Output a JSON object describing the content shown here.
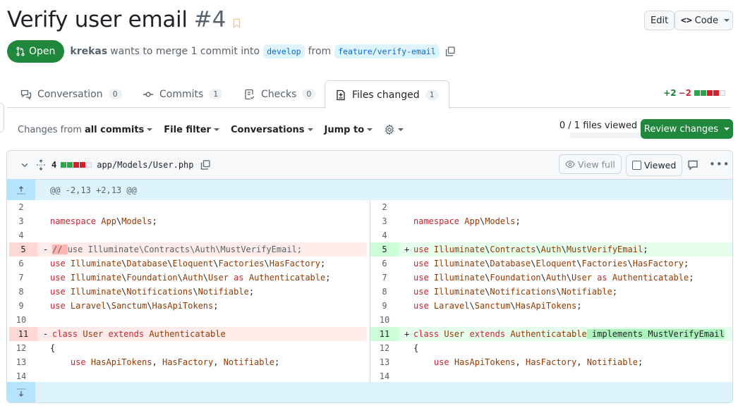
{
  "header": {
    "title": "Verify user email",
    "number": "#4",
    "edit_label": "Edit",
    "code_label": "Code",
    "code_icon": "<>"
  },
  "meta": {
    "state": "Open",
    "author": "krekas",
    "merge_text": "wants to merge 1 commit into",
    "base_branch": "develop",
    "from_text": "from",
    "head_branch": "feature/verify-email"
  },
  "tabs": [
    {
      "label": "Conversation",
      "count": "0",
      "icon": "comment-discussion-icon"
    },
    {
      "label": "Commits",
      "count": "1",
      "icon": "git-commit-icon"
    },
    {
      "label": "Checks",
      "count": "0",
      "icon": "checklist-icon"
    },
    {
      "label": "Files changed",
      "count": "1",
      "icon": "file-diff-icon",
      "active": true
    }
  ],
  "diffstat": {
    "additions": "+2",
    "deletions": "−2",
    "blocks": [
      "added",
      "added",
      "deleted",
      "deleted",
      "neutral"
    ]
  },
  "toolbar": {
    "changes_from_prefix": "Changes from",
    "changes_from_value": "all commits",
    "file_filter": "File filter",
    "conversations": "Conversations",
    "jump_to": "Jump to",
    "files_viewed": "0 / 1 files viewed",
    "files_viewed_fraction": 0,
    "review_changes": "Review changes"
  },
  "file": {
    "changed_count": "4",
    "path": "app/Models/User.php",
    "view_full": "View full",
    "viewed": "Viewed",
    "viewed_checked": false,
    "hunk_header": "@@ -2,13 +2,13 @@"
  },
  "colors": {
    "open_green": "#1f883d",
    "addition_bg": "#e6ffec",
    "deletion_bg": "#ffebe9",
    "hunk_bg": "#ddf4ff",
    "branch_blue": "#0969da"
  },
  "diff": {
    "left": [
      {
        "num": "2",
        "type": "ctx",
        "tokens": []
      },
      {
        "num": "3",
        "type": "ctx",
        "tokens": [
          [
            "kw",
            "namespace"
          ],
          [
            "",
            " "
          ],
          [
            "nm",
            "App"
          ],
          [
            "",
            "\\"
          ],
          [
            "nm",
            "Models"
          ],
          [
            "",
            ";"
          ]
        ]
      },
      {
        "num": "4",
        "type": "ctx",
        "tokens": []
      },
      {
        "num": "5",
        "type": "del",
        "tokens": [
          [
            "cm hl-del",
            "//"
          ],
          [
            "hl-del",
            " "
          ],
          [
            "cm",
            "use Illuminate\\Contracts\\Auth\\MustVerifyEmail;"
          ]
        ]
      },
      {
        "num": "6",
        "type": "ctx",
        "tokens": [
          [
            "kw",
            "use"
          ],
          [
            "",
            " "
          ],
          [
            "nm",
            "Illuminate"
          ],
          [
            "",
            "\\"
          ],
          [
            "nm",
            "Database"
          ],
          [
            "",
            "\\"
          ],
          [
            "nm",
            "Eloquent"
          ],
          [
            "",
            "\\"
          ],
          [
            "nm",
            "Factories"
          ],
          [
            "",
            "\\"
          ],
          [
            "nm",
            "HasFactory"
          ],
          [
            "",
            ";"
          ]
        ]
      },
      {
        "num": "7",
        "type": "ctx",
        "tokens": [
          [
            "kw",
            "use"
          ],
          [
            "",
            " "
          ],
          [
            "nm",
            "Illuminate"
          ],
          [
            "",
            "\\"
          ],
          [
            "nm",
            "Foundation"
          ],
          [
            "",
            "\\"
          ],
          [
            "nm",
            "Auth"
          ],
          [
            "",
            "\\"
          ],
          [
            "nm",
            "User"
          ],
          [
            "",
            " "
          ],
          [
            "kw",
            "as"
          ],
          [
            "",
            " "
          ],
          [
            "nm",
            "Authenticatable"
          ],
          [
            "",
            ";"
          ]
        ]
      },
      {
        "num": "8",
        "type": "ctx",
        "tokens": [
          [
            "kw",
            "use"
          ],
          [
            "",
            " "
          ],
          [
            "nm",
            "Illuminate"
          ],
          [
            "",
            "\\"
          ],
          [
            "nm",
            "Notifications"
          ],
          [
            "",
            "\\"
          ],
          [
            "nm",
            "Notifiable"
          ],
          [
            "",
            ";"
          ]
        ]
      },
      {
        "num": "9",
        "type": "ctx",
        "tokens": [
          [
            "kw",
            "use"
          ],
          [
            "",
            " "
          ],
          [
            "nm",
            "Laravel"
          ],
          [
            "",
            "\\"
          ],
          [
            "nm",
            "Sanctum"
          ],
          [
            "",
            "\\"
          ],
          [
            "nm",
            "HasApiTokens"
          ],
          [
            "",
            ";"
          ]
        ]
      },
      {
        "num": "10",
        "type": "ctx",
        "tokens": []
      },
      {
        "num": "11",
        "type": "del",
        "tokens": [
          [
            "kw",
            "class"
          ],
          [
            "",
            " "
          ],
          [
            "nm",
            "User"
          ],
          [
            "",
            " "
          ],
          [
            "kw",
            "extends"
          ],
          [
            "",
            " "
          ],
          [
            "nm",
            "Authenticatable"
          ]
        ]
      },
      {
        "num": "12",
        "type": "ctx",
        "tokens": [
          [
            "",
            "{"
          ]
        ]
      },
      {
        "num": "13",
        "type": "ctx",
        "tokens": [
          [
            "",
            "    "
          ],
          [
            "kw",
            "use"
          ],
          [
            "",
            " "
          ],
          [
            "nm",
            "HasApiTokens"
          ],
          [
            "",
            ", "
          ],
          [
            "nm",
            "HasFactory"
          ],
          [
            "",
            ", "
          ],
          [
            "nm",
            "Notifiable"
          ],
          [
            "",
            ";"
          ]
        ]
      },
      {
        "num": "14",
        "type": "ctx",
        "tokens": []
      }
    ],
    "right": [
      {
        "num": "2",
        "type": "ctx",
        "tokens": []
      },
      {
        "num": "3",
        "type": "ctx",
        "tokens": [
          [
            "kw",
            "namespace"
          ],
          [
            "",
            " "
          ],
          [
            "nm",
            "App"
          ],
          [
            "",
            "\\"
          ],
          [
            "nm",
            "Models"
          ],
          [
            "",
            ";"
          ]
        ]
      },
      {
        "num": "4",
        "type": "ctx",
        "tokens": []
      },
      {
        "num": "5",
        "type": "add",
        "tokens": [
          [
            "kw",
            "use"
          ],
          [
            "",
            " "
          ],
          [
            "nm",
            "Illuminate"
          ],
          [
            "",
            "\\"
          ],
          [
            "nm",
            "Contracts"
          ],
          [
            "",
            "\\"
          ],
          [
            "nm",
            "Auth"
          ],
          [
            "",
            "\\"
          ],
          [
            "nm",
            "MustVerifyEmail"
          ],
          [
            "",
            ";"
          ]
        ]
      },
      {
        "num": "6",
        "type": "ctx",
        "tokens": [
          [
            "kw",
            "use"
          ],
          [
            "",
            " "
          ],
          [
            "nm",
            "Illuminate"
          ],
          [
            "",
            "\\"
          ],
          [
            "nm",
            "Database"
          ],
          [
            "",
            "\\"
          ],
          [
            "nm",
            "Eloquent"
          ],
          [
            "",
            "\\"
          ],
          [
            "nm",
            "Factories"
          ],
          [
            "",
            "\\"
          ],
          [
            "nm",
            "HasFactory"
          ],
          [
            "",
            ";"
          ]
        ]
      },
      {
        "num": "7",
        "type": "ctx",
        "tokens": [
          [
            "kw",
            "use"
          ],
          [
            "",
            " "
          ],
          [
            "nm",
            "Illuminate"
          ],
          [
            "",
            "\\"
          ],
          [
            "nm",
            "Foundation"
          ],
          [
            "",
            "\\"
          ],
          [
            "nm",
            "Auth"
          ],
          [
            "",
            "\\"
          ],
          [
            "nm",
            "User"
          ],
          [
            "",
            " "
          ],
          [
            "kw",
            "as"
          ],
          [
            "",
            " "
          ],
          [
            "nm",
            "Authenticatable"
          ],
          [
            "",
            ";"
          ]
        ]
      },
      {
        "num": "8",
        "type": "ctx",
        "tokens": [
          [
            "kw",
            "use"
          ],
          [
            "",
            " "
          ],
          [
            "nm",
            "Illuminate"
          ],
          [
            "",
            "\\"
          ],
          [
            "nm",
            "Notifications"
          ],
          [
            "",
            "\\"
          ],
          [
            "nm",
            "Notifiable"
          ],
          [
            "",
            ";"
          ]
        ]
      },
      {
        "num": "9",
        "type": "ctx",
        "tokens": [
          [
            "kw",
            "use"
          ],
          [
            "",
            " "
          ],
          [
            "nm",
            "Laravel"
          ],
          [
            "",
            "\\"
          ],
          [
            "nm",
            "Sanctum"
          ],
          [
            "",
            "\\"
          ],
          [
            "nm",
            "HasApiTokens"
          ],
          [
            "",
            ";"
          ]
        ]
      },
      {
        "num": "10",
        "type": "ctx",
        "tokens": []
      },
      {
        "num": "11",
        "type": "add",
        "tokens": [
          [
            "kw",
            "class"
          ],
          [
            "",
            " "
          ],
          [
            "nm",
            "User"
          ],
          [
            "",
            " "
          ],
          [
            "kw",
            "extends"
          ],
          [
            "",
            " "
          ],
          [
            "nm",
            "Authenticatable"
          ],
          [
            "hl-add",
            " implements MustVerifyEmail"
          ]
        ]
      },
      {
        "num": "12",
        "type": "ctx",
        "tokens": [
          [
            "",
            "{"
          ]
        ]
      },
      {
        "num": "13",
        "type": "ctx",
        "tokens": [
          [
            "",
            "    "
          ],
          [
            "kw",
            "use"
          ],
          [
            "",
            " "
          ],
          [
            "nm",
            "HasApiTokens"
          ],
          [
            "",
            ", "
          ],
          [
            "nm",
            "HasFactory"
          ],
          [
            "",
            ", "
          ],
          [
            "nm",
            "Notifiable"
          ],
          [
            "",
            ";"
          ]
        ]
      },
      {
        "num": "14",
        "type": "ctx",
        "tokens": []
      }
    ]
  }
}
